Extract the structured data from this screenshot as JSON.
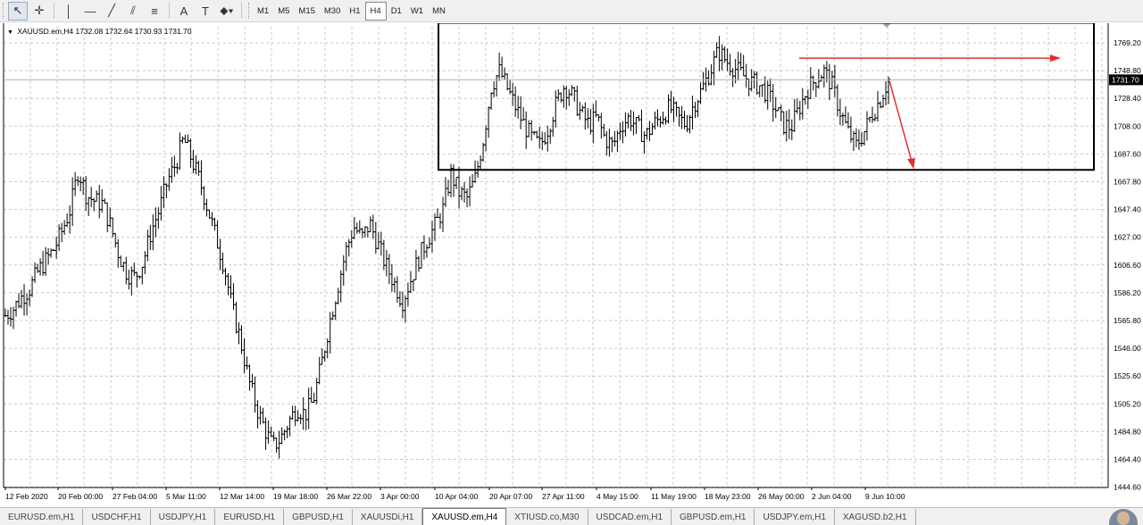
{
  "toolbar": {
    "tools": [
      {
        "icon": "cursor-arrow-icon",
        "glyph": "↖",
        "active": true
      },
      {
        "icon": "crosshair-icon",
        "glyph": "✛",
        "active": false
      },
      {
        "icon": "vertical-line-icon",
        "glyph": "│",
        "active": false
      },
      {
        "icon": "horizontal-line-icon",
        "glyph": "—",
        "active": false
      },
      {
        "icon": "trendline-icon",
        "glyph": "╱",
        "active": false
      },
      {
        "icon": "equidistant-channel-icon",
        "glyph": "⫽",
        "active": false
      },
      {
        "icon": "fibonacci-icon",
        "glyph": "≡",
        "active": false
      },
      {
        "icon": "text-icon",
        "glyph": "A",
        "active": false
      },
      {
        "icon": "text-label-icon",
        "glyph": "T",
        "active": false
      },
      {
        "icon": "arrows-shapes-icon",
        "glyph": "⬥▾",
        "active": false
      }
    ],
    "timeframes": [
      "M1",
      "M5",
      "M15",
      "M30",
      "H1",
      "H4",
      "D1",
      "W1",
      "MN"
    ],
    "active_timeframe": "H4"
  },
  "chart": {
    "title": "XAUUSD.em,H4  1732.08 1732.64 1730.93 1731.70",
    "current_price_label": "1731.70",
    "price_axis_labels": [
      "1769.20",
      "1748.80",
      "1728.40",
      "1708.00",
      "1687.60",
      "1667.80",
      "1647.40",
      "1627.00",
      "1606.60",
      "1586.20",
      "1565.80",
      "1546.00",
      "1525.60",
      "1505.20",
      "1484.80",
      "1464.40",
      "1444.60"
    ],
    "time_axis_labels": [
      "12 Feb 2020",
      "20 Feb 00:00",
      "27 Feb 04:00",
      "5 Mar 11:00",
      "12 Mar 14:00",
      "19 Mar 18:00",
      "26 Mar 22:00",
      "3 Apr 00:00",
      "10 Apr 04:00",
      "20 Apr 07:00",
      "27 Apr 11:00",
      "4 May 15:00",
      "11 May 19:00",
      "18 May 23:00",
      "26 May 00:00",
      "2 Jun 04:00",
      "9 Jun 10:00"
    ],
    "colors": {
      "bars": "#000000",
      "grid": "#c8c8c8",
      "annotation_box": "#000000",
      "arrows": "#e03030",
      "price_tag_bg": "#000000"
    }
  },
  "chart_data": {
    "type": "ohlc",
    "symbol": "XAUUSD.em",
    "timeframe": "H4",
    "last": {
      "open": 1732.08,
      "high": 1732.64,
      "low": 1730.93,
      "close": 1731.7
    },
    "ylim": [
      1444.6,
      1769.2
    ],
    "grid": true,
    "approx_close_path": [
      1565,
      1570,
      1578,
      1584,
      1596,
      1604,
      1612,
      1625,
      1640,
      1668,
      1650,
      1646,
      1644,
      1628,
      1608,
      1595,
      1592,
      1603,
      1625,
      1640,
      1660,
      1672,
      1690,
      1675,
      1660,
      1640,
      1620,
      1600,
      1570,
      1548,
      1520,
      1500,
      1485,
      1472,
      1478,
      1490,
      1500,
      1495,
      1505,
      1530,
      1560,
      1585,
      1610,
      1628,
      1620,
      1630,
      1615,
      1600,
      1588,
      1575,
      1590,
      1605,
      1618,
      1628,
      1640,
      1665,
      1652,
      1648,
      1662,
      1690,
      1728,
      1738,
      1725,
      1712,
      1700,
      1690,
      1685,
      1698,
      1715,
      1728,
      1720,
      1708,
      1700,
      1705,
      1690,
      1685,
      1700,
      1705,
      1698,
      1692,
      1700,
      1706,
      1712,
      1705,
      1700,
      1715,
      1725,
      1738,
      1752,
      1745,
      1740,
      1735,
      1730,
      1728,
      1722,
      1712,
      1700,
      1698,
      1712,
      1725,
      1732,
      1738,
      1728,
      1710,
      1695,
      1685,
      1695,
      1708,
      1718,
      1732
    ],
    "annotations": [
      {
        "type": "rectangle",
        "from": "10 Apr 04:00",
        "to": "after 9 Jun 10:00",
        "price_top": 1772,
        "price_bottom": 1668
      },
      {
        "type": "arrow",
        "direction": "right",
        "price": 1747
      },
      {
        "type": "arrow",
        "direction": "down",
        "from_price": 1731,
        "to_price": 1670
      }
    ]
  },
  "tabs": [
    "EURUSD.em,H1",
    "USDCHF,H1",
    "USDJPY,H1",
    "EURUSD,H1",
    "GBPUSD,H1",
    "XAUUSDi,H1",
    "XAUUSD.em,H4",
    "XTIUSD.co,M30",
    "USDCAD.em,H1",
    "GBPUSD.em,H1",
    "USDJPY.em,H1",
    "XAGUSD.b2,H1"
  ],
  "active_tab": "XAUUSD.em,H4"
}
